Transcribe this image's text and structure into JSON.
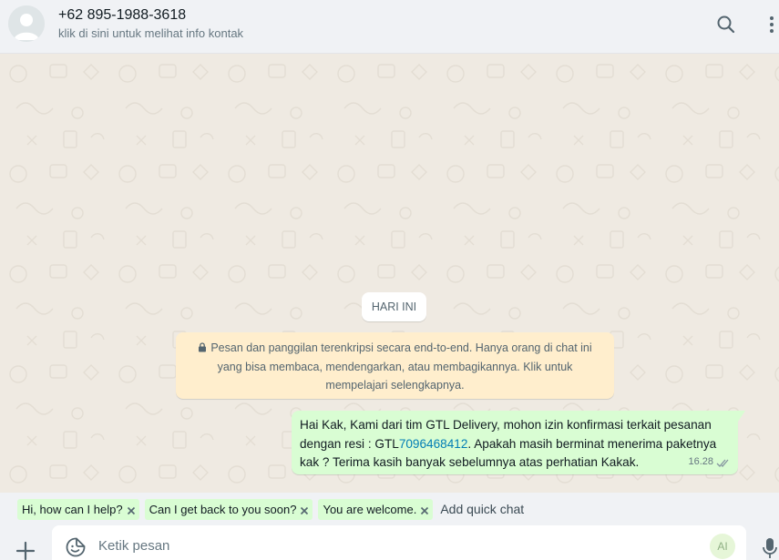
{
  "header": {
    "contact_name": "+62 895-1988-3618",
    "contact_subtitle": "klik di sini untuk melihat info kontak",
    "icons": [
      "default-avatar-icon",
      "search-icon",
      "kebab-menu-icon"
    ]
  },
  "chat": {
    "day_label": "HARI INI",
    "encryption_notice": "Pesan dan panggilan terenkripsi secara end-to-end. Hanya orang di chat ini yang bisa membaca, mendengarkan, atau membagikannya. Klik untuk mempelajari selengkapnya.",
    "message": {
      "text_before": "Hai Kak, Kami dari tim GTL Delivery, mohon izin konfirmasi terkait pesanan dengan resi : GTL",
      "link_text": "7096468412",
      "text_after": ". Apakah masih berminat menerima paketnya kak ? Terima kasih banyak sebelumnya atas perhatian Kakak.",
      "time": "16.28",
      "status_icon": "double-check-icon"
    }
  },
  "quick_chats": {
    "chips": [
      {
        "label": "Hi, how can I help?"
      },
      {
        "label": "Can I get back to you soon?"
      },
      {
        "label": "You are welcome."
      }
    ],
    "add_label": "Add quick chat"
  },
  "composer": {
    "placeholder": "Ketik pesan",
    "ai_label": "AI"
  },
  "colors": {
    "outgoing_bubble": "#d9fdd3",
    "notice_bg": "#ffeecd",
    "chat_bg": "#efeae2",
    "link": "#027eb5"
  }
}
